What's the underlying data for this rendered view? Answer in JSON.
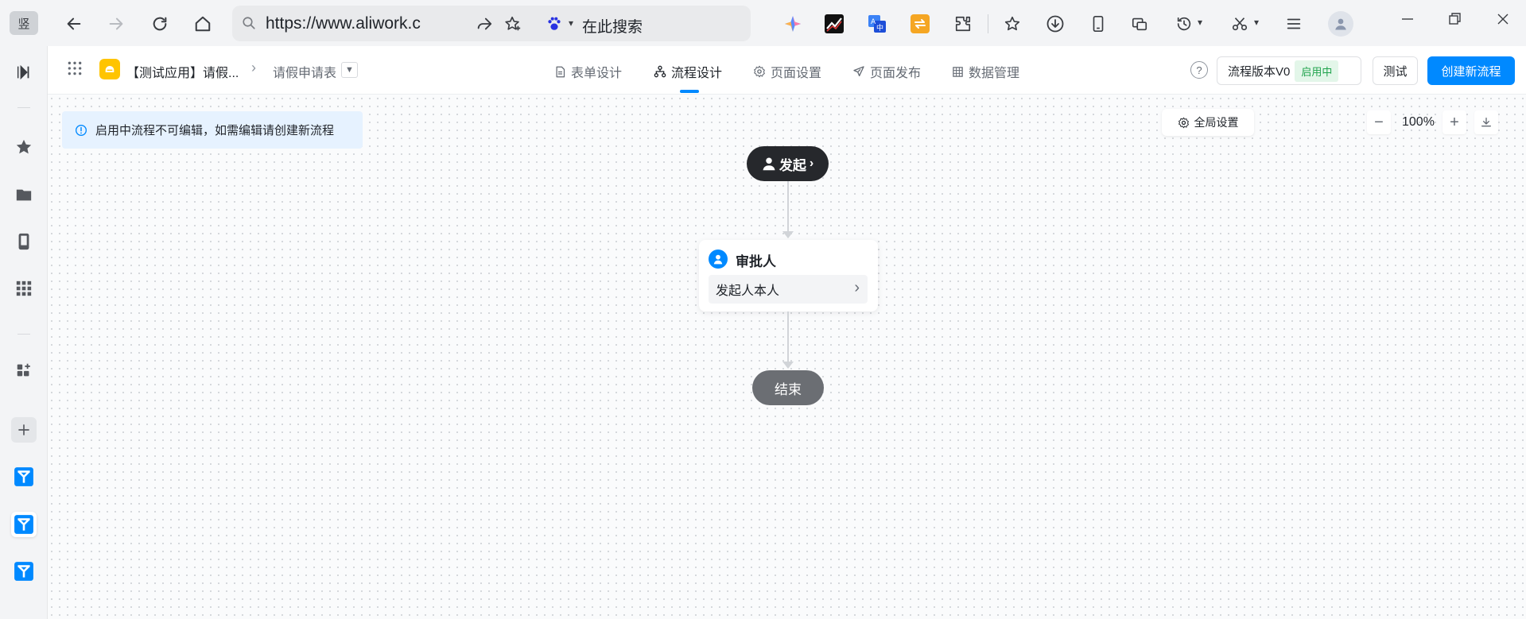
{
  "browser": {
    "url": "https://www.aliwork.c",
    "search_placeholder": "在此搜索",
    "rail_badge": "竖"
  },
  "header": {
    "app_name": "【测试应用】请假...",
    "form_name": "请假申请表",
    "tabs": [
      {
        "label": "表单设计",
        "icon": "document-icon"
      },
      {
        "label": "流程设计",
        "icon": "flow-icon",
        "active": true
      },
      {
        "label": "页面设置",
        "icon": "gear-icon"
      },
      {
        "label": "页面发布",
        "icon": "send-icon"
      },
      {
        "label": "数据管理",
        "icon": "table-icon"
      }
    ],
    "version_label": "流程版本V0",
    "version_status": "启用中",
    "test_button": "测试",
    "create_button": "创建新流程"
  },
  "canvas": {
    "notice": "启用中流程不可编辑，如需编辑请创建新流程",
    "global_settings": "全局设置",
    "zoom": "100%",
    "start_node": "发起",
    "approver_title": "审批人",
    "approver_value": "发起人本人",
    "end_node": "结束"
  },
  "colors": {
    "primary": "#0089ff",
    "start_node_bg": "#26282c",
    "end_node_bg": "#6b6e73",
    "status_green": "#1fa34c",
    "notice_bg": "#e6f2ff",
    "app_icon_yellow": "#ffc400"
  }
}
